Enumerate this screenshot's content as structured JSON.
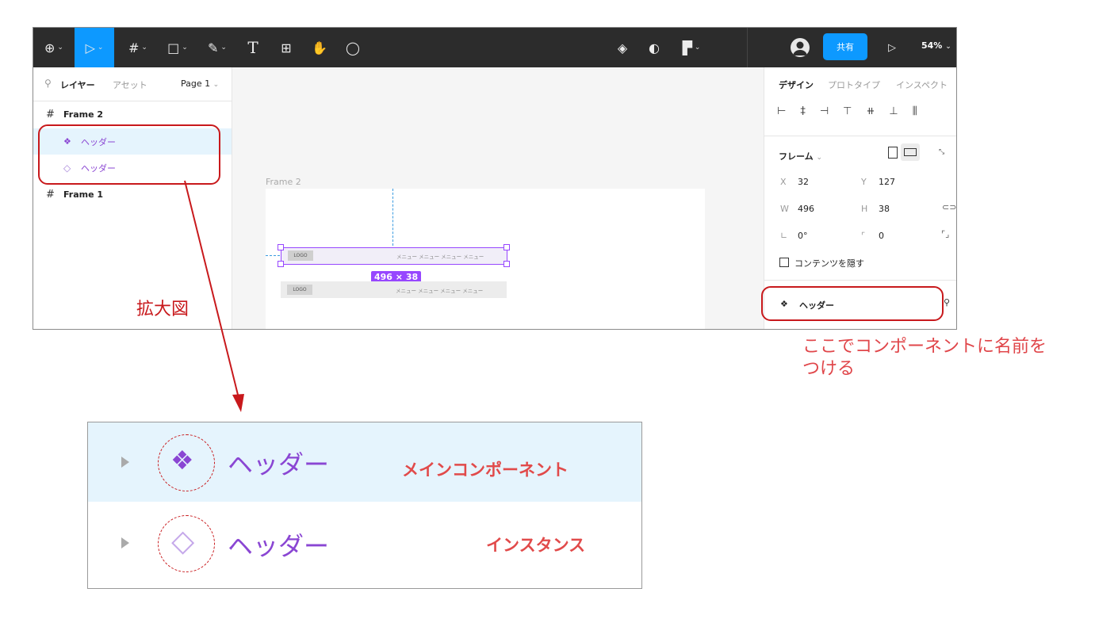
{
  "toolbar": {
    "tools": [
      {
        "name": "figma-menu-icon",
        "glyph": "⊕"
      },
      {
        "name": "move-tool-icon",
        "glyph": "▷"
      },
      {
        "name": "frame-tool-icon",
        "glyph": "#"
      },
      {
        "name": "rectangle-tool-icon",
        "glyph": "□"
      },
      {
        "name": "pen-tool-icon",
        "glyph": "✎"
      },
      {
        "name": "text-tool-icon",
        "glyph": "T"
      },
      {
        "name": "resources-tool-icon",
        "glyph": "⊞"
      },
      {
        "name": "hand-tool-icon",
        "glyph": "✋"
      },
      {
        "name": "comment-tool-icon",
        "glyph": "◯"
      }
    ],
    "share_label": "共有",
    "zoom": "54%",
    "accent": "#0d99ff"
  },
  "left_panel": {
    "tabs": [
      "レイヤー",
      "アセット"
    ],
    "page": "Page 1",
    "layers": [
      {
        "label": "Frame 2",
        "kind": "frame"
      },
      {
        "label": "ヘッダー",
        "kind": "main-component"
      },
      {
        "label": "ヘッダー",
        "kind": "instance"
      },
      {
        "label": "Frame 1",
        "kind": "frame"
      }
    ]
  },
  "canvas": {
    "frame_label": "Frame 2",
    "logo_text": "LOGO",
    "menu_text": "メニュー メニュー メニュー メニュー",
    "size_badge": "496 × 38"
  },
  "right_panel": {
    "tabs": [
      "デザイン",
      "プロトタイプ",
      "インスペクト"
    ],
    "section_title": "フレーム",
    "x_label": "X",
    "x_value": "32",
    "y_label": "Y",
    "y_value": "127",
    "w_label": "W",
    "w_value": "496",
    "h_label": "H",
    "h_value": "38",
    "rotation": "0°",
    "radius": "0",
    "clip_label": "コンテンツを隠す",
    "component_name": "ヘッダー"
  },
  "annotations": {
    "zoom_label": "拡大図",
    "name_note_line1": "ここでコンポーネントに名前を",
    "name_note_line2": "つける",
    "callout_color": "#c8191c",
    "text_color": "#e0464a"
  },
  "zoom_view": {
    "rows": [
      {
        "name": "ヘッダー",
        "label": "メインコンポーネント"
      },
      {
        "name": "ヘッダー",
        "label": "インスタンス"
      }
    ],
    "component_color": "#8a46d3"
  }
}
